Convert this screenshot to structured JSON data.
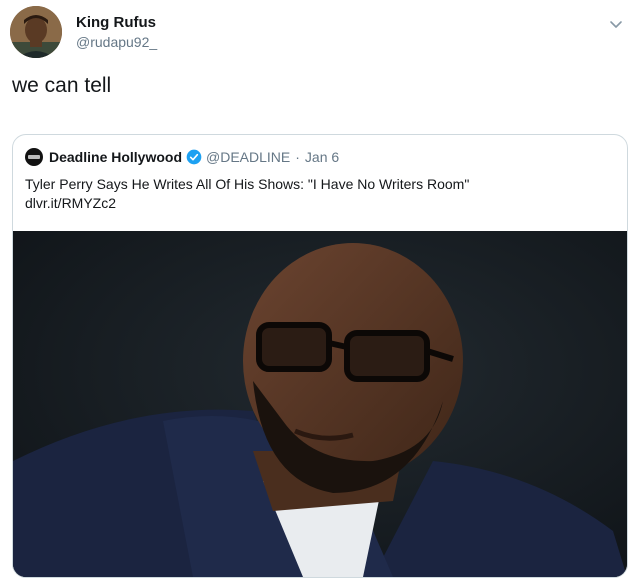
{
  "tweet": {
    "display_name": "King Rufus",
    "handle": "@rudapu92_",
    "text": "we can tell"
  },
  "quote": {
    "display_name": "Deadline Hollywood",
    "handle": "@DEADLINE",
    "separator": "·",
    "date": "Jan 6",
    "text": "Tyler Perry Says He Writes All Of His Shows: \"I Have No Writers Room\"",
    "link": "dlvr.it/RMYZc2",
    "verified": true
  },
  "icons": {
    "menu": "chevron-down-icon",
    "verified": "verified-badge-icon"
  },
  "colors": {
    "text_primary": "#14171a",
    "text_secondary": "#657786",
    "verified_blue": "#1da1f2",
    "card_border": "#cfd9de"
  }
}
